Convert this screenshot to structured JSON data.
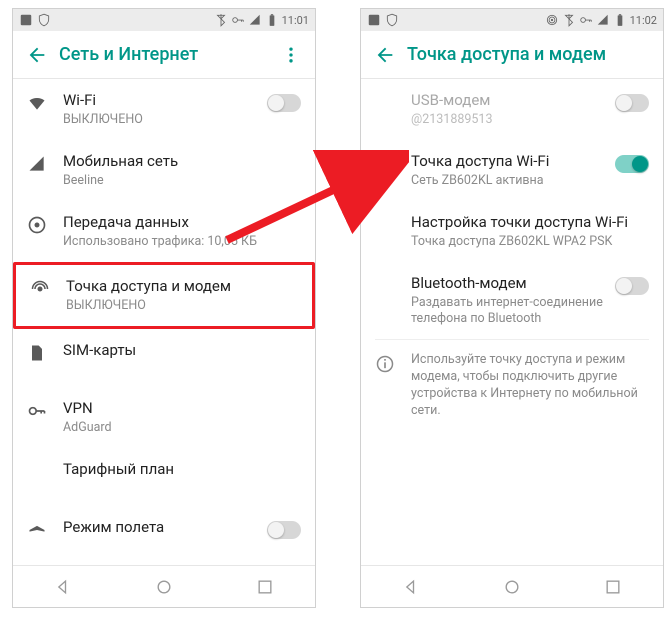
{
  "statusbar": {
    "time_left": "11:01",
    "time_right": "11:02"
  },
  "left": {
    "title": "Сеть и Интернет",
    "items": [
      {
        "key": "wifi",
        "title": "Wi-Fi",
        "sub": "ВЫКЛЮЧЕНО",
        "toggle": "off"
      },
      {
        "key": "mobile",
        "title": "Мобильная сеть",
        "sub": "Beeline"
      },
      {
        "key": "data",
        "title": "Передача данных",
        "sub": "Использовано трафика: 10,05 КБ"
      },
      {
        "key": "hotspot",
        "title": "Точка доступа и модем",
        "sub": "ВЫКЛЮЧЕНО",
        "highlight": true
      },
      {
        "key": "sim",
        "title": "SIM-карты"
      },
      {
        "key": "vpn",
        "title": "VPN",
        "sub": "AdGuard"
      },
      {
        "key": "plan",
        "title": "Тарифный план"
      },
      {
        "key": "airplane",
        "title": "Режим полета",
        "toggle": "off"
      }
    ]
  },
  "right": {
    "title": "Точка доступа и модем",
    "items": [
      {
        "key": "usb",
        "title": "USB-модем",
        "sub": "@2131889513",
        "toggle": "off",
        "disabled": true
      },
      {
        "key": "ap",
        "title": "Точка доступа Wi-Fi",
        "sub": "Сеть ZB602KL активна",
        "toggle": "on"
      },
      {
        "key": "apcfg",
        "title": "Настройка точки доступа Wi-Fi",
        "sub": "Точка доступа ZB602KL WPA2 PSK"
      },
      {
        "key": "bt",
        "title": "Bluetooth-модем",
        "sub": "Раздавать интернет-соединение телефона по Bluetooth",
        "toggle": "off"
      }
    ],
    "info": "Используйте точку доступа и режим модема, чтобы подключить другие устройства к Интернету по мобильной сети."
  }
}
